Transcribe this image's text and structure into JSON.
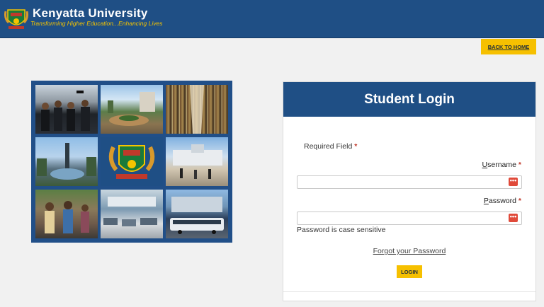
{
  "header": {
    "brand_name": "Kenyatta University",
    "tagline": "Transforming Higher Education...Enhancing Lives",
    "crest_icon": "university-crest-icon"
  },
  "nav": {
    "back_label": "BACK TO HOME"
  },
  "collage": {
    "tiles": [
      "graduation-photo",
      "campus-roundabout-photo",
      "library-photo",
      "monument-fountain-photo",
      "university-crest",
      "campus-building-photo",
      "students-walking-photo",
      "lecture-hall-photo",
      "campus-bus-photo"
    ]
  },
  "login": {
    "title": "Student Login",
    "required_text": "Required Field",
    "required_star": "*",
    "username_label_first": "U",
    "username_label_rest": "sername",
    "password_label_first": "P",
    "password_label_rest": "assword",
    "username_value": "",
    "password_value": "",
    "password_hint": "Password is case sensitive",
    "forgot_label": "Forgot your Password",
    "submit_label": "LOGIN",
    "field_icon_glyph": "•••"
  },
  "colors": {
    "primary": "#1f4f85",
    "accent": "#f6c000",
    "background": "#f1f1f1",
    "required": "#c0392b"
  }
}
